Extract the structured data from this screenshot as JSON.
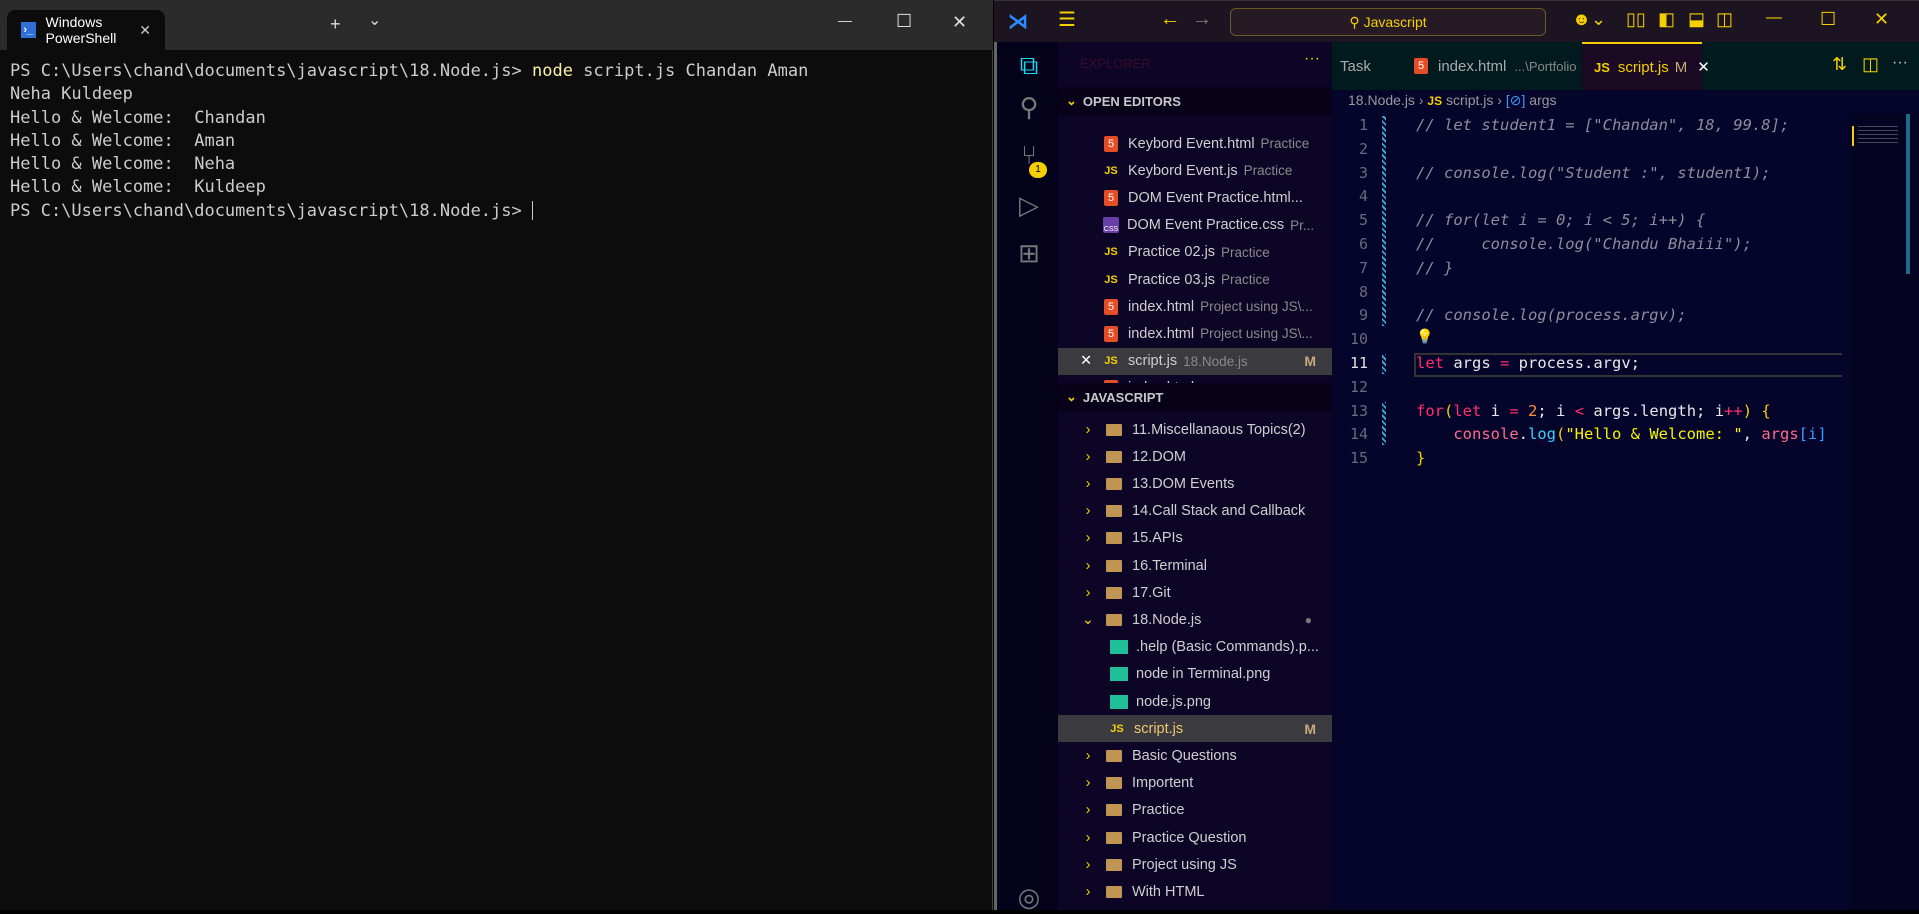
{
  "terminal": {
    "tab_title": "Windows PowerShell",
    "new_tab": "+",
    "dropdown": "⌄",
    "min": "—",
    "max": "☐",
    "close": "✕",
    "lines": [
      {
        "prompt": "PS C:\\Users\\chand\\documents\\javascript\\18.Node.js> ",
        "cmd": "node",
        "rest": " script.js Chandan Aman"
      },
      {
        "text": "Neha Kuldeep"
      },
      {
        "text": "Hello & Welcome:  Chandan"
      },
      {
        "text": "Hello & Welcome:  Aman"
      },
      {
        "text": "Hello & Welcome:  Neha"
      },
      {
        "text": "Hello & Welcome:  Kuldeep"
      },
      {
        "prompt": "PS C:\\Users\\chand\\documents\\javascript\\18.Node.js> ",
        "cursor": true
      }
    ]
  },
  "vscode": {
    "search": "Javascript",
    "explorer_label": "EXPLORER",
    "open_editors_label": "OPEN EDITORS",
    "open_editors": [
      {
        "icon": "html",
        "name": "Keybord Event.html",
        "desc": "Practice"
      },
      {
        "icon": "js",
        "name": "Keybord Event.js",
        "desc": "Practice"
      },
      {
        "icon": "html",
        "name": "DOM Event Practice.html...",
        "desc": ""
      },
      {
        "icon": "css",
        "name": "DOM Event Practice.css",
        "desc": "Pr..."
      },
      {
        "icon": "js",
        "name": "Practice 02.js",
        "desc": "Practice"
      },
      {
        "icon": "js",
        "name": "Practice 03.js",
        "desc": "Practice"
      },
      {
        "icon": "html",
        "name": "index.html",
        "desc": "Project using JS\\..."
      },
      {
        "icon": "html",
        "name": "index.html",
        "desc": "Project using JS\\..."
      },
      {
        "icon": "js",
        "name": "script.js",
        "desc": "18.Node.js",
        "badge": "M",
        "selected": true,
        "close": "✕"
      },
      {
        "icon": "html",
        "name": "index.html",
        "desc": "Project using JS\\..."
      }
    ],
    "folder_label": "JAVASCRIPT",
    "tree": [
      {
        "type": "folder",
        "name": "11.Miscellanaous Topics(2)"
      },
      {
        "type": "folder",
        "name": "12.DOM"
      },
      {
        "type": "folder",
        "name": "13.DOM Events"
      },
      {
        "type": "folder",
        "name": "14.Call Stack and Callback"
      },
      {
        "type": "folder",
        "name": "15.APIs"
      },
      {
        "type": "folder",
        "name": "16.Terminal"
      },
      {
        "type": "folder",
        "name": "17.Git"
      },
      {
        "type": "folder",
        "name": "18.Node.js",
        "open": true
      },
      {
        "type": "img",
        "name": ".help (Basic Commands).p..."
      },
      {
        "type": "img",
        "name": "node in Terminal.png"
      },
      {
        "type": "img",
        "name": "node.js.png"
      },
      {
        "type": "js",
        "name": "script.js",
        "badge": "M",
        "selected": true
      },
      {
        "type": "folder",
        "name": "Basic Questions"
      },
      {
        "type": "folder",
        "name": "Importent"
      },
      {
        "type": "folder",
        "name": "Practice"
      },
      {
        "type": "folder",
        "name": "Practice Question"
      },
      {
        "type": "folder",
        "name": "Project using JS"
      },
      {
        "type": "folder",
        "name": "With HTML"
      }
    ],
    "tabs": [
      {
        "name": "Task",
        "desc": ""
      },
      {
        "name": "index.html",
        "desc": "...\\Portfolio"
      },
      {
        "name": "script.js",
        "desc": "M",
        "active": true
      }
    ],
    "breadcrumb": [
      "18.Node.js",
      "script.js",
      "args"
    ],
    "scm_badge": "1",
    "code": [
      [
        [
          "// let student1 = [\"Chandan\", 18, 99.8];",
          "cmt"
        ]
      ],
      [],
      [
        [
          "// console.log(\"Student :\", student1);",
          "cmt"
        ]
      ],
      [],
      [
        [
          "// for(let i = 0; i < 5; i++) {",
          "cmt"
        ]
      ],
      [
        [
          "//     console.log(\"Chandu Bhaiii\");",
          "cmt"
        ]
      ],
      [
        [
          "// }",
          "cmt"
        ]
      ],
      [],
      [
        [
          "// console.log(process.argv);",
          "cmt"
        ]
      ],
      [],
      [
        [
          "let",
          "kw"
        ],
        [
          " args ",
          "pl"
        ],
        [
          "=",
          "op"
        ],
        [
          " process.argv;",
          "pl"
        ]
      ],
      [],
      [
        [
          "for",
          "kw"
        ],
        [
          "(",
          "br"
        ],
        [
          "let",
          "kw"
        ],
        [
          " i ",
          "pl"
        ],
        [
          "=",
          "op"
        ],
        [
          " ",
          "pl"
        ],
        [
          "2",
          "num"
        ],
        [
          "; i ",
          "pl"
        ],
        [
          "<",
          "op"
        ],
        [
          " args.length; i",
          "pl"
        ],
        [
          "++",
          "op"
        ],
        [
          ") ",
          "br"
        ],
        [
          "{",
          "br"
        ]
      ],
      [
        [
          "    ",
          "pl"
        ],
        [
          "console",
          "var"
        ],
        [
          ".",
          "pl"
        ],
        [
          "log",
          "fn"
        ],
        [
          "(",
          "br"
        ],
        [
          "\"Hello & Welcome: \"",
          "str"
        ],
        [
          ", ",
          "pl"
        ],
        [
          "args",
          "var"
        ],
        [
          "[i]",
          "br2"
        ]
      ],
      [
        [
          "}",
          "br"
        ]
      ]
    ]
  }
}
